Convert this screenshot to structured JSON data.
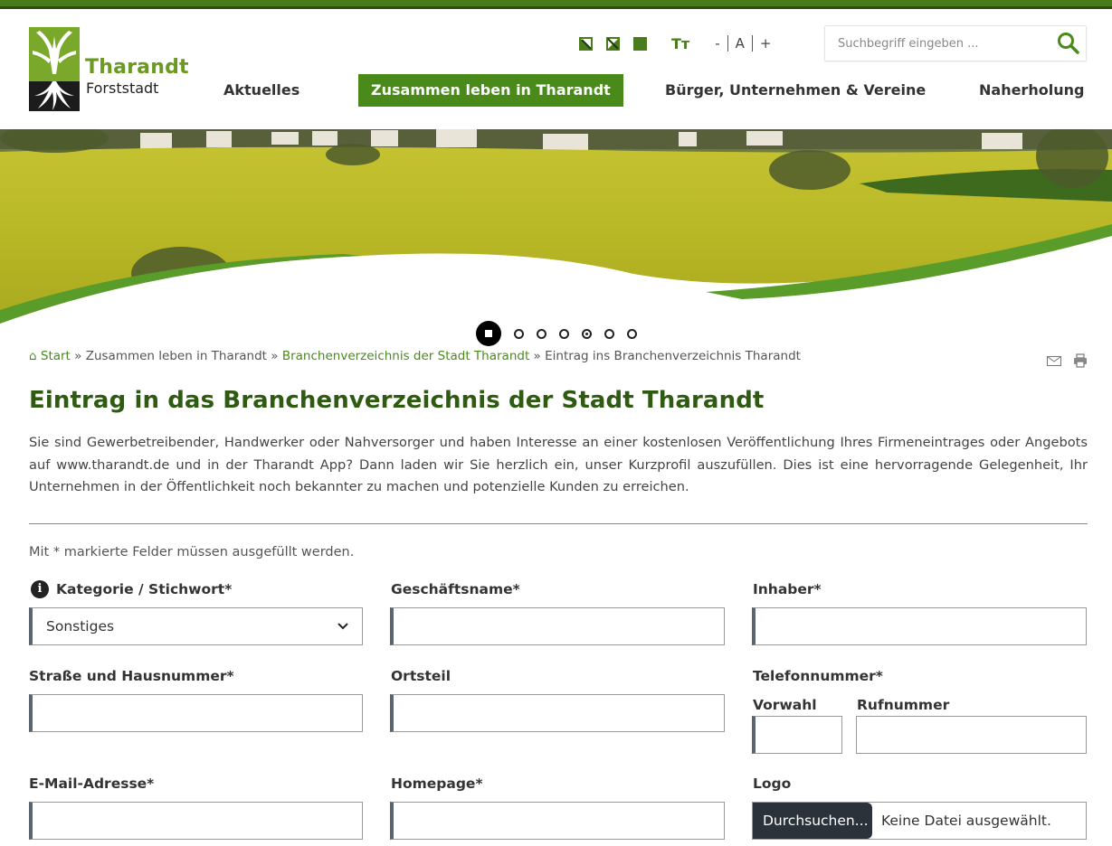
{
  "header": {
    "logo_title": "Tharandt",
    "logo_subtitle": "Forststadt",
    "contrast_icons": [
      "contrast-normal-icon",
      "contrast-inverted-icon",
      "contrast-high-icon"
    ],
    "font_size_icon": "Tт",
    "font_smaller": "-",
    "font_normal": "A",
    "font_larger": "+",
    "search_placeholder": "Suchbegriff eingeben ...",
    "accent_color": "#4a8a1a"
  },
  "nav": {
    "items": [
      {
        "label": "Aktuelles",
        "active": false
      },
      {
        "label": "Zusammen leben in Tharandt",
        "active": true
      },
      {
        "label": "Bürger, Unternehmen & Vereine",
        "active": false
      },
      {
        "label": "Naherholung",
        "active": false
      }
    ]
  },
  "slider": {
    "slide_count": 6,
    "active_index": 3
  },
  "breadcrumb": {
    "home": "Start",
    "sep": "»",
    "level1": "Zusammen leben in Tharandt",
    "level2": "Branchenverzeichnis der Stadt Tharandt",
    "current": "Eintrag ins Branchenverzeichnis Tharandt"
  },
  "page": {
    "title": "Eintrag in das Branchenverzeichnis der Stadt Tharandt",
    "intro": "Sie sind Gewerbetreibender, Handwerker oder Nahversorger und haben Interesse an einer kostenlosen Veröffentlichung Ihres Firmeneintrages oder Angebots auf www.tharandt.de und in der Tharandt App? Dann laden wir Sie herzlich ein, unser Kurzprofil auszufüllen. Dies ist eine hervorragende Gelegenheit, Ihr Unternehmen in der Öffentlichkeit noch bekannter zu machen und potenzielle Kunden zu erreichen.",
    "required_note": "Mit * markierte Felder müssen ausgefüllt werden."
  },
  "form": {
    "category_label": "Kategorie / Stichwort*",
    "category_value": "Sonstiges",
    "business_name_label": "Geschäftsname*",
    "business_name_value": "",
    "owner_label": "Inhaber*",
    "owner_value": "",
    "street_label": "Straße und Hausnummer*",
    "street_value": "",
    "district_label": "Ortsteil",
    "district_value": "",
    "phone_label": "Telefonnummer*",
    "area_code_label": "Vorwahl",
    "area_code_value": "",
    "number_label": "Rufnummer",
    "number_value": "",
    "email_label": "E-Mail-Adresse*",
    "email_value": "",
    "homepage_label": "Homepage*",
    "homepage_value": "",
    "logo_label": "Logo",
    "browse_button": "Durchsuchen...",
    "no_file": "Keine Datei ausgewählt."
  }
}
